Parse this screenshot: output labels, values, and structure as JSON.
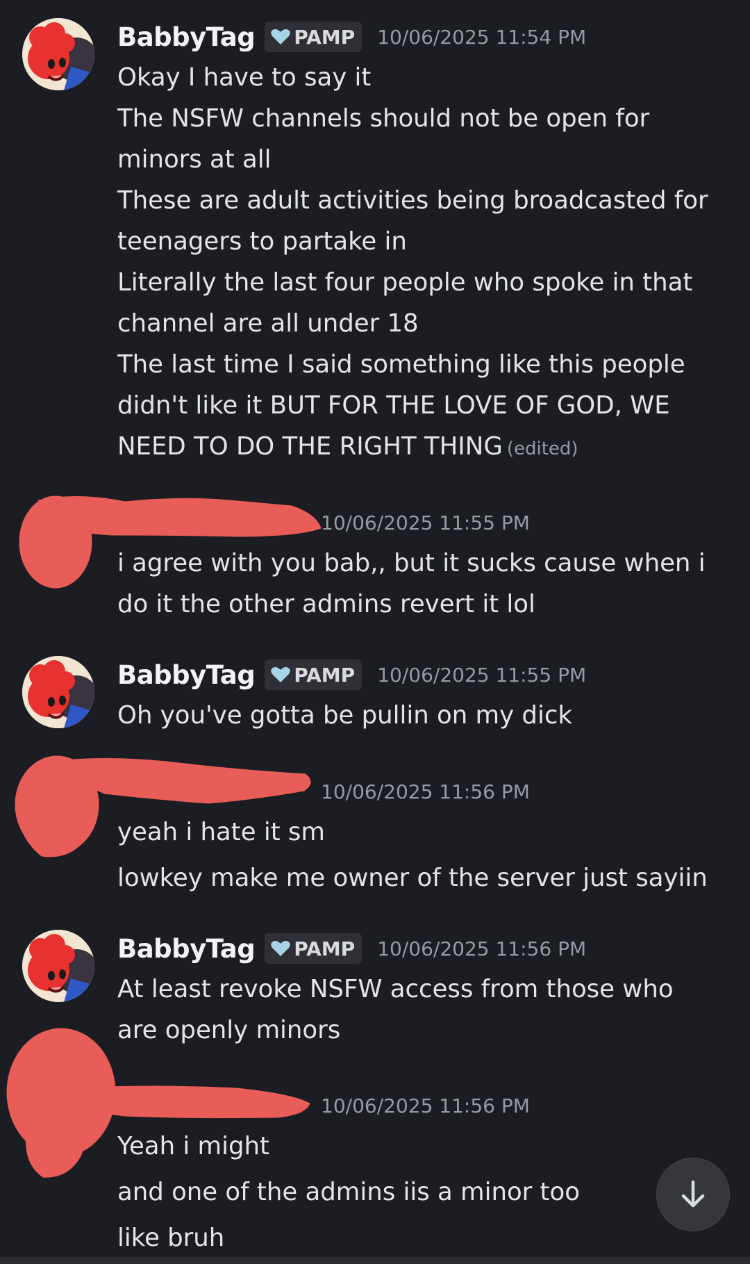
{
  "messages": [
    {
      "author": "BabbyTag",
      "tag": "PAMP",
      "timestamp": "10/06/2025 11:54 PM",
      "lines": [
        "Okay I have to say it",
        "The NSFW channels should not be open for",
        "minors at all",
        "These are adult activities being broadcasted for",
        "teenagers to partake in",
        "Literally the last four people who spoke in that",
        "channel are all under 18",
        "The last time I said something like this people",
        "didn't like it BUT FOR THE LOVE OF GOD, WE",
        "NEED TO DO THE RIGHT THING"
      ],
      "edited": "(edited)"
    },
    {
      "timestamp": "10/06/2025 11:55 PM",
      "lines": [
        "i agree with you bab,, but it sucks cause when i",
        "do it the other admins revert it lol"
      ]
    },
    {
      "author": "BabbyTag",
      "tag": "PAMP",
      "timestamp": "10/06/2025 11:55 PM",
      "lines": [
        "Oh you've gotta be pullin on my dick"
      ]
    },
    {
      "timestamp": "10/06/2025 11:56 PM",
      "lines": [
        "yeah i hate it sm",
        "lowkey make me owner of the server just sayiin"
      ]
    },
    {
      "author": "BabbyTag",
      "tag": "PAMP",
      "timestamp": "10/06/2025 11:56 PM",
      "lines": [
        "At least revoke NSFW access from those who",
        "are openly minors"
      ]
    },
    {
      "timestamp": "10/06/2025 11:56 PM",
      "lines": [
        "Yeah i might",
        "and one of the admins iis a minor too",
        "like bruh"
      ]
    }
  ],
  "icons": {
    "tag_badge": "heart-badge-icon",
    "scroll_button": "arrow-down-icon"
  },
  "colors": {
    "background": "#1c1d22",
    "redaction": "#e85d57",
    "timestamp": "#949ba4"
  }
}
